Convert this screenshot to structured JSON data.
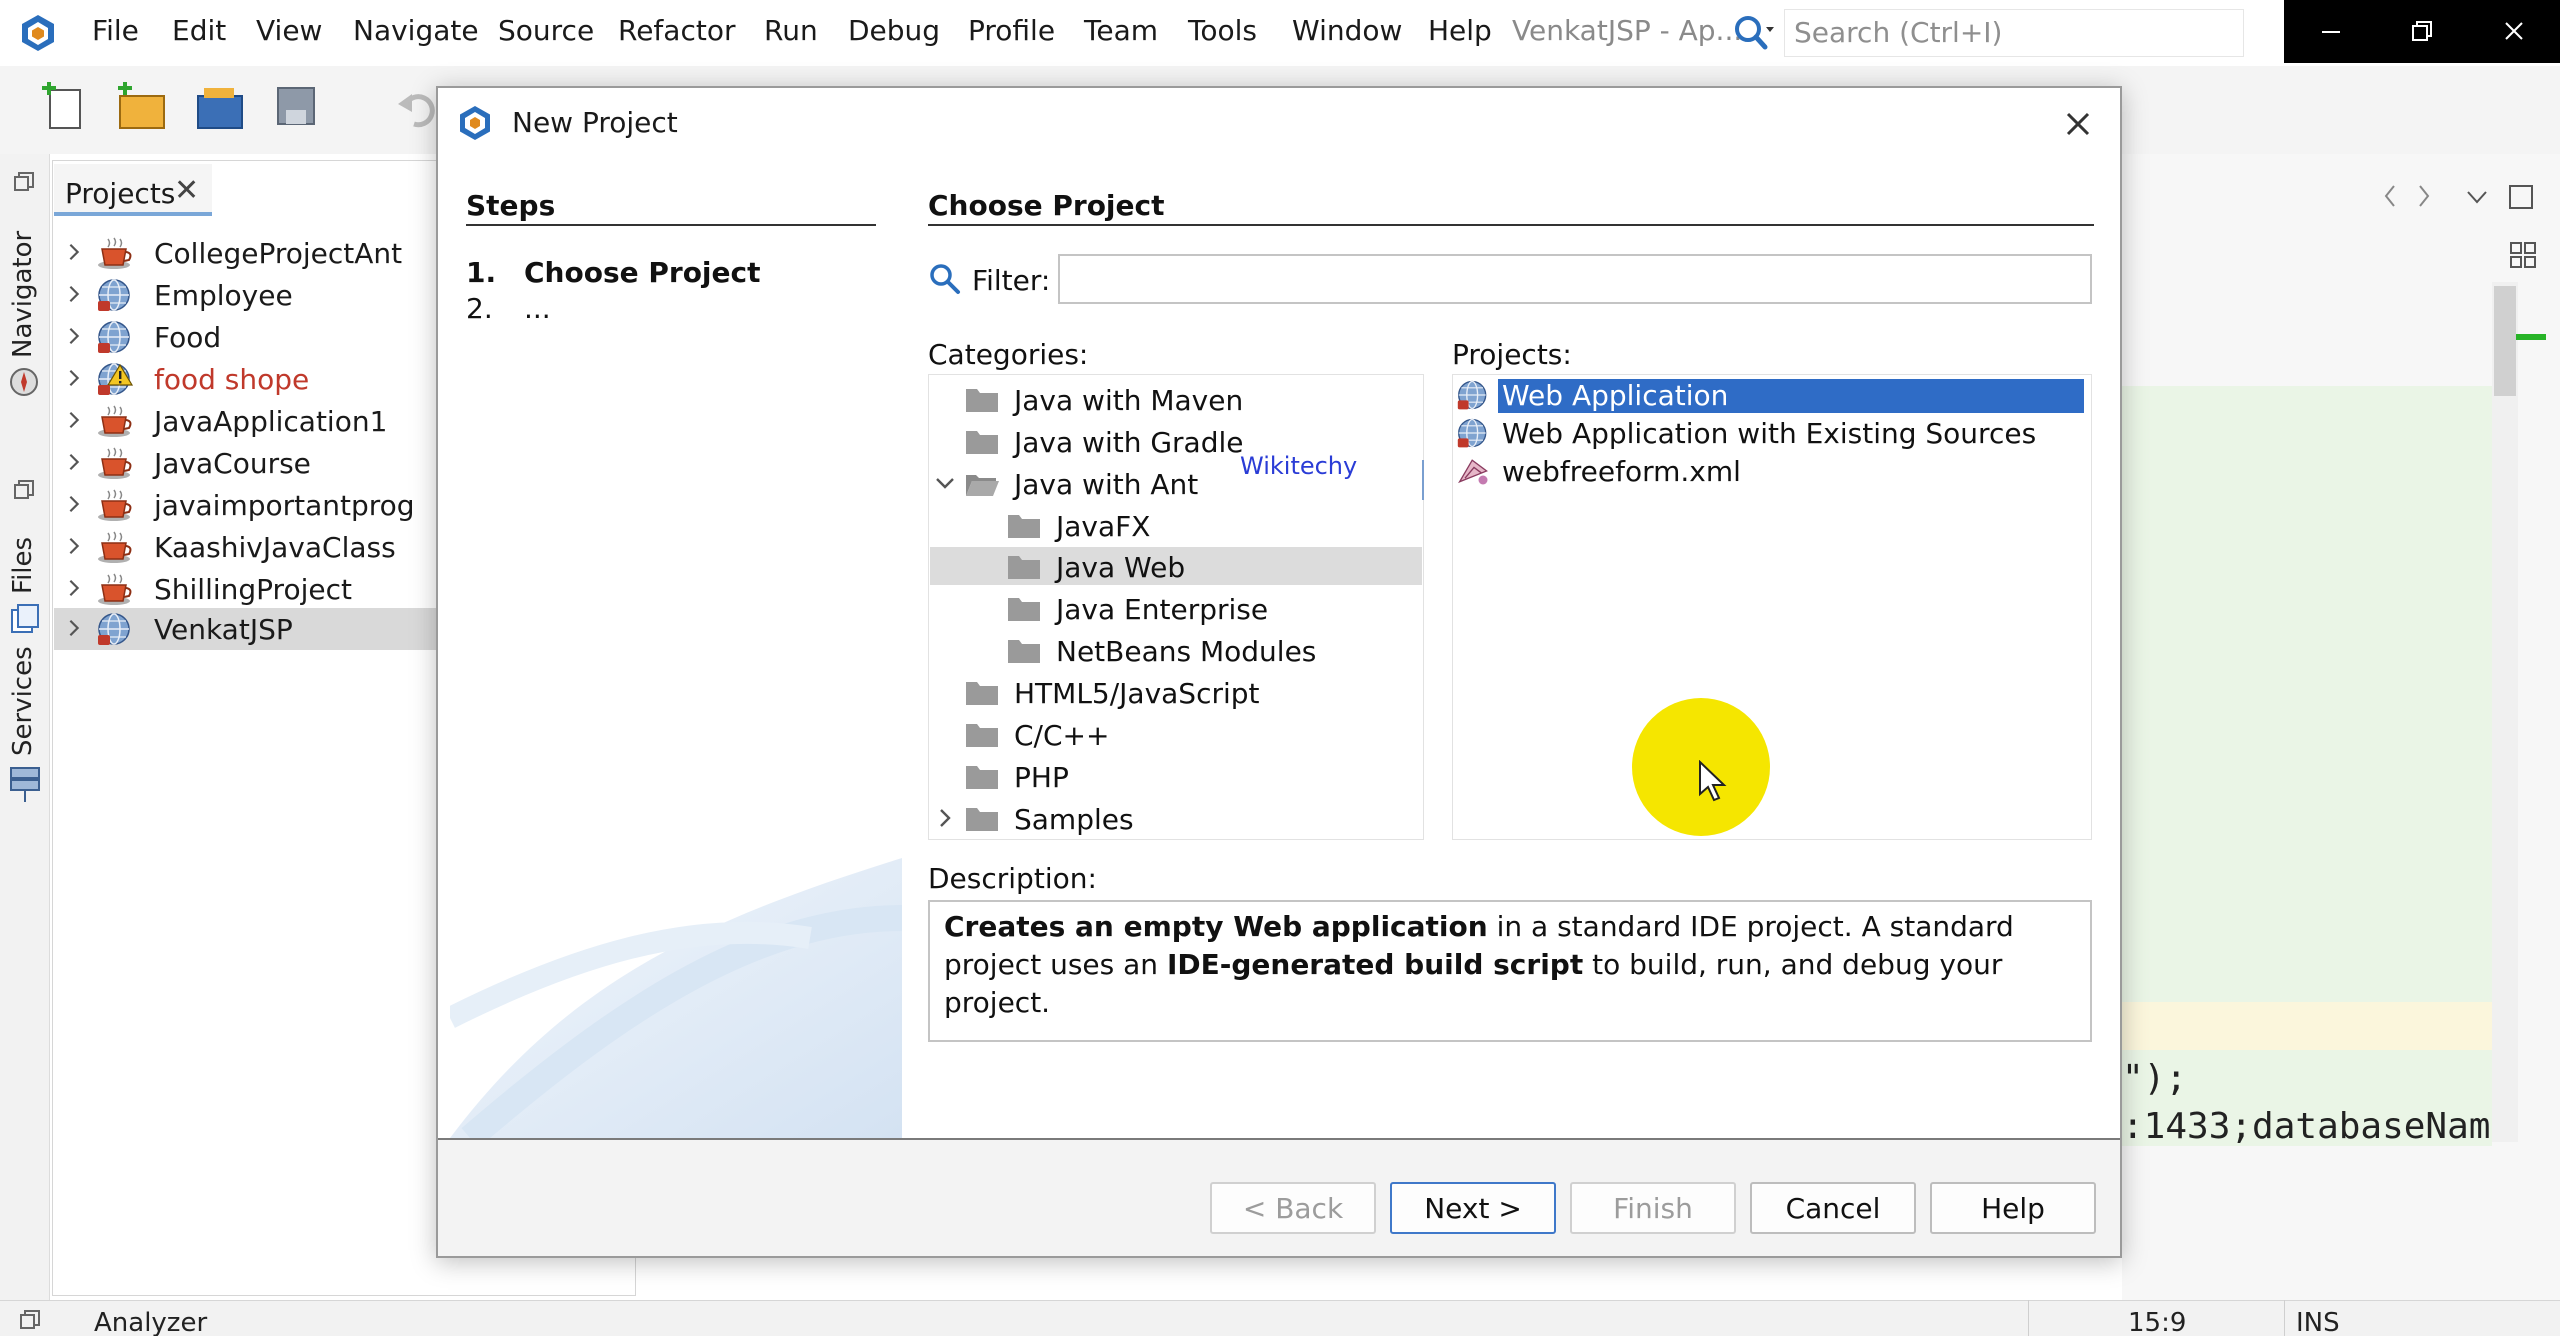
{
  "menubar": {
    "items": [
      "File",
      "Edit",
      "View",
      "Navigate",
      "Source",
      "Refactor",
      "Run",
      "Debug",
      "Profile",
      "Team",
      "Tools",
      "Window",
      "Help"
    ],
    "window_title": "VenkatJSP - Ap...",
    "search_placeholder": "Search (Ctrl+I)"
  },
  "left_strip": {
    "tabs": [
      "Navigator",
      "Files",
      "Services"
    ]
  },
  "projects_panel": {
    "tab_label": "Projects",
    "close_glyph": "✕",
    "items": [
      {
        "label": "CollegeProjectAnt",
        "icon": "coffee-cup-icon"
      },
      {
        "label": "Employee",
        "icon": "globe-icon"
      },
      {
        "label": "Food",
        "icon": "globe-icon"
      },
      {
        "label": "food shope",
        "icon": "globe-warning-icon"
      },
      {
        "label": "JavaApplication1",
        "icon": "coffee-cup-icon"
      },
      {
        "label": "JavaCourse",
        "icon": "coffee-cup-icon"
      },
      {
        "label": "javaimportantprog",
        "icon": "coffee-cup-icon"
      },
      {
        "label": "KaashivJavaClass",
        "icon": "coffee-cup-icon"
      },
      {
        "label": "ShillingProject",
        "icon": "coffee-cup-icon"
      },
      {
        "label": "VenkatJSP",
        "icon": "globe-icon"
      }
    ]
  },
  "dialog": {
    "title": "New Project",
    "steps_title": "Steps",
    "steps": [
      {
        "num": "1.",
        "label": "Choose Project"
      },
      {
        "num": "2.",
        "label": "..."
      }
    ],
    "section_title": "Choose Project",
    "filter_label": "Filter:",
    "filter_value": "",
    "categories_label": "Categories:",
    "projects_label": "Projects:",
    "categories": [
      {
        "label": "Java with Maven"
      },
      {
        "label": "Java with Gradle"
      },
      {
        "label": "Java with Ant"
      },
      {
        "label": "JavaFX"
      },
      {
        "label": "Java Web"
      },
      {
        "label": "Java Enterprise"
      },
      {
        "label": "NetBeans Modules"
      },
      {
        "label": "HTML5/JavaScript"
      },
      {
        "label": "C/C++"
      },
      {
        "label": "PHP"
      },
      {
        "label": "Samples"
      }
    ],
    "projects": [
      {
        "label": "Web Application",
        "icon": "globe-icon"
      },
      {
        "label": "Web Application with Existing Sources",
        "icon": "globe-icon"
      },
      {
        "label": "webfreeform.xml",
        "icon": "web-freeform-icon"
      }
    ],
    "watermark": "Wikitechy",
    "description_label": "Description:",
    "description": {
      "part1_bold": "Creates an empty Web application",
      "part2": " in a standard IDE project. A standard project uses an ",
      "part3_bold": "IDE-generated build script",
      "part4": " to build, run, and debug your project."
    },
    "buttons": {
      "back": "< Back",
      "next": "Next >",
      "finish": "Finish",
      "cancel": "Cancel",
      "help": "Help"
    }
  },
  "editor": {
    "code_line_1": "\");",
    "code_line_2": ":1433;databaseNam"
  },
  "statusbar": {
    "left": "Analyzer",
    "position": "15:9",
    "mode": "INS"
  },
  "colors": {
    "selection": "#2f6cc6",
    "highlight": "#f5e600",
    "error_text": "#c0392b"
  }
}
